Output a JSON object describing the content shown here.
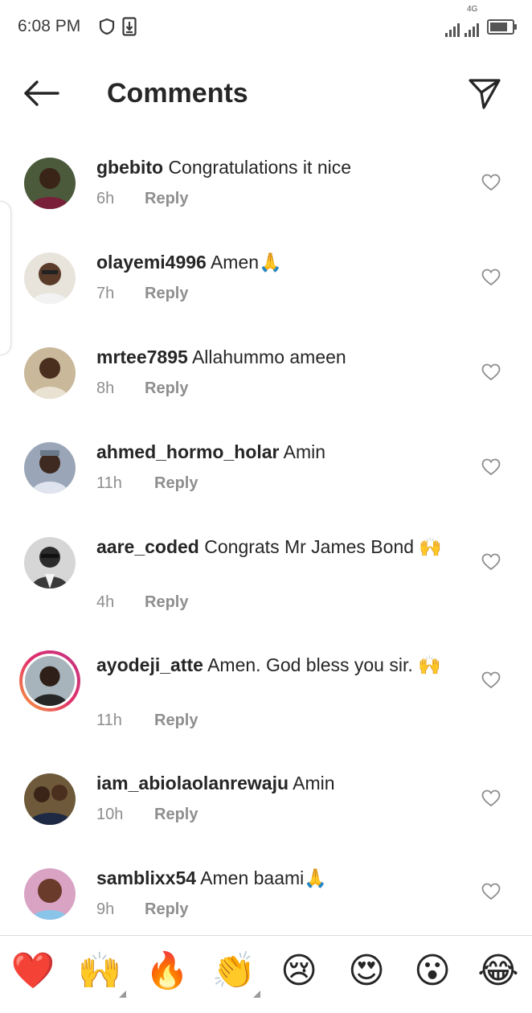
{
  "status_bar": {
    "time": "6:08 PM",
    "network": "4G"
  },
  "header": {
    "title": "Comments"
  },
  "comments": [
    {
      "username": "gbebito",
      "text": "Congratulations it nice",
      "time": "6h",
      "reply": "Reply"
    },
    {
      "username": "olayemi4996",
      "text": "Amen🙏",
      "time": "7h",
      "reply": "Reply"
    },
    {
      "username": "mrtee7895",
      "text": "Allahummo ameen",
      "time": "8h",
      "reply": "Reply"
    },
    {
      "username": "ahmed_hormo_holar",
      "text": "Amin",
      "time": "11h",
      "reply": "Reply"
    },
    {
      "username": "aare_coded",
      "text": "Congrats Mr James Bond 🙌",
      "time": "4h",
      "reply": "Reply"
    },
    {
      "username": "ayodeji_atte",
      "text": "Amen. God bless you sir. 🙌",
      "time": "11h",
      "reply": "Reply"
    },
    {
      "username": "iam_abiolaolanrewaju",
      "text": "Amin",
      "time": "10h",
      "reply": "Reply"
    },
    {
      "username": "samblixx54",
      "text": "Amen baami🙏",
      "time": "9h",
      "reply": "Reply"
    }
  ],
  "emoji_bar": [
    "❤️",
    "🙌",
    "🔥",
    "👏",
    "😢",
    "😍",
    "😮",
    "😂"
  ],
  "colors": {
    "text": "#262626",
    "secondary": "#8e8e8e",
    "heart_red": "#ed4956"
  }
}
